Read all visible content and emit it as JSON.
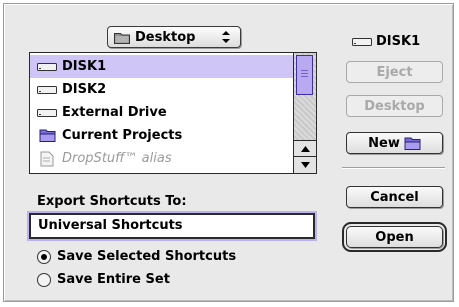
{
  "location_popup": {
    "label": "Desktop",
    "icon": "folder-icon"
  },
  "file_list": {
    "items": [
      {
        "name": "DISK1",
        "icon": "hard-disk-icon",
        "selected": true
      },
      {
        "name": "DISK2",
        "icon": "hard-disk-icon",
        "selected": false
      },
      {
        "name": "External Drive",
        "icon": "hard-disk-icon",
        "selected": false
      },
      {
        "name": "Current Projects",
        "icon": "folder-icon",
        "selected": false
      },
      {
        "name": "DropStuff™ alias",
        "icon": "alias-icon",
        "selected": false
      }
    ]
  },
  "volume": {
    "label": "DISK1",
    "icon": "hard-disk-icon"
  },
  "buttons": {
    "eject": "Eject",
    "desktop": "Desktop",
    "new": "New",
    "cancel": "Cancel",
    "open": "Open"
  },
  "export": {
    "label": "Export Shortcuts To:",
    "value": "Universal Shortcuts"
  },
  "options": {
    "save_selected": "Save Selected Shortcuts",
    "save_entire": "Save Entire Set",
    "selected": "save_selected"
  },
  "colors": {
    "selection": "#cfc5f6",
    "focus_ring": "#bcb2f0",
    "dialog_bg": "#e9e9e9"
  }
}
